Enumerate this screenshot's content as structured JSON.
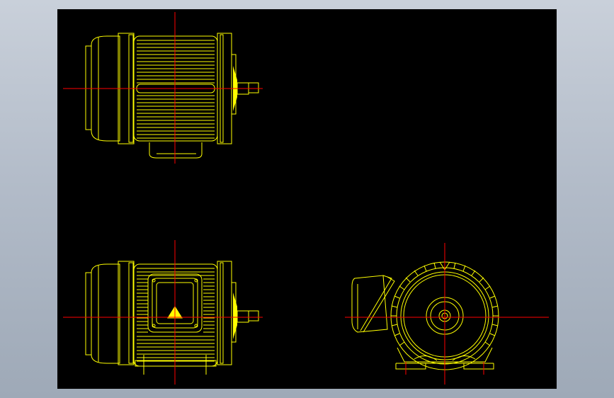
{
  "window": {
    "background_color": "#b3bcc9",
    "canvas_color": "#000000"
  },
  "drawing": {
    "line_color": "#ffff00",
    "centerline_color": "#ff0000",
    "views": [
      {
        "name": "top-view",
        "description_icon": "motor-top-view"
      },
      {
        "name": "side-view",
        "description_icon": "motor-side-view"
      },
      {
        "name": "end-view",
        "description_icon": "motor-end-view"
      }
    ]
  }
}
